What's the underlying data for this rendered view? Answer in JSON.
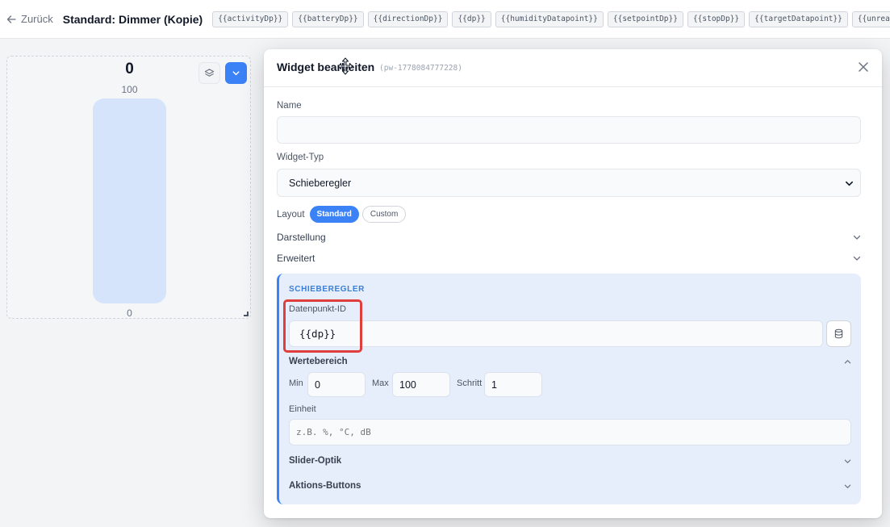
{
  "topbar": {
    "back_label": "Zurück",
    "page_title": "Standard: Dimmer (Kopie)",
    "placeholders": [
      "{{activityDp}}",
      "{{batteryDp}}",
      "{{directionDp}}",
      "{{dp}}",
      "{{humidityDatapoint}}",
      "{{setpointDp}}",
      "{{stopDp}}",
      "{{targetDatapoint}}",
      "{{unreachDp}}"
    ]
  },
  "preview": {
    "value": "0",
    "max_label": "100",
    "min_label": "0",
    "fill_fraction": 0
  },
  "modal": {
    "title": "Widget bearbeiten",
    "id": "(pw-1778084777228)",
    "name_label": "Name",
    "name_value": "",
    "type_label": "Widget-Typ",
    "type_value": "Schieberegler",
    "layout_label": "Layout",
    "layout_options": [
      "Standard",
      "Custom"
    ],
    "layout_selected": "Standard",
    "accordion_darstellung": "Darstellung",
    "accordion_erweitert": "Erweitert"
  },
  "slider": {
    "section_title": "SCHIEBEREGLER",
    "datapoint_label": "Datenpunkt-ID",
    "datapoint_value": "{{dp}}",
    "range_title": "Wertebereich",
    "min_label": "Min",
    "min_value": "0",
    "max_label": "Max",
    "max_value": "100",
    "step_label": "Schritt",
    "step_value": "1",
    "unit_label": "Einheit",
    "unit_placeholder": "z.B. %, °C, dB",
    "optik_title": "Slider-Optik",
    "buttons_title": "Aktions-Buttons"
  },
  "colors": {
    "accent": "#3b82f6",
    "section_bg": "#e7eefb",
    "highlight": "#e03d3d"
  }
}
